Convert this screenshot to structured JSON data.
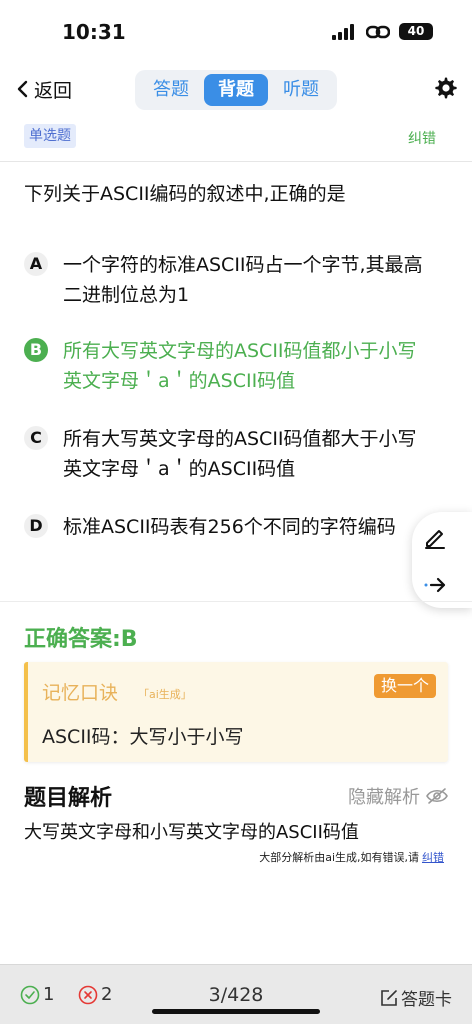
{
  "status_bar": {
    "time": "10:31",
    "battery": "40"
  },
  "nav": {
    "back_label": "返回",
    "tabs": [
      {
        "label": "答题",
        "active": false
      },
      {
        "label": "背题",
        "active": true
      },
      {
        "label": "听题",
        "active": false
      }
    ]
  },
  "meta": {
    "type_badge": "单选题",
    "report_label": "纠错"
  },
  "question": {
    "text": "下列关于ASCII编码的叙述中,正确的是",
    "options": [
      {
        "letter": "A",
        "text": "一个字符的标准ASCII码占一个字节,其最高二进制位总为1",
        "correct": false
      },
      {
        "letter": "B",
        "text": "所有大写英文字母的ASCII码值都小于小写英文字母＇a＇的ASCII码值",
        "correct": true
      },
      {
        "letter": "C",
        "text": "所有大写英文字母的ASCII码值都大于小写英文字母＇a＇的ASCII码值",
        "correct": false
      },
      {
        "letter": "D",
        "text": "标准ASCII码表有256个不同的字符编码",
        "correct": false
      }
    ]
  },
  "answer": {
    "label": "正确答案:B"
  },
  "memory": {
    "title": "记忆口诀",
    "ai_tag": "「ai生成」",
    "swap_label": "换一个",
    "text": "ASCII码：大写小于小写"
  },
  "analysis": {
    "title": "题目解析",
    "hide_label": "隐藏解析",
    "text": "大写英文字母和小写英文字母的ASCII码值",
    "note": "大部分解析由ai生成,如有错误,请",
    "note_link": "纠错"
  },
  "bottom": {
    "correct_count": "1",
    "wrong_count": "2",
    "progress": "3/428",
    "card_label": "答题卡"
  },
  "colors": {
    "accent_blue": "#3a8ee6",
    "correct_green": "#4caf50",
    "wrong_red": "#e53935",
    "memory_orange": "#ef9a32"
  },
  "icons": [
    "back-chevron-icon",
    "gear-icon",
    "signal-icon",
    "link-icon",
    "pencil-icon",
    "arrow-right-icon",
    "eye-off-icon",
    "check-circle-icon",
    "x-circle-icon",
    "edit-icon"
  ]
}
